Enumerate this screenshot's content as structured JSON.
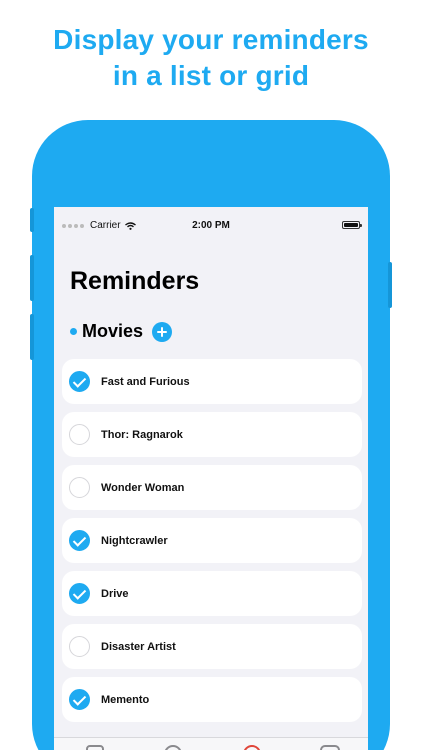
{
  "headline": {
    "line1": "Display your reminders",
    "line2": "in a list or grid"
  },
  "status_bar": {
    "carrier": "Carrier",
    "time": "2:00 PM"
  },
  "app": {
    "title": "Reminders",
    "section": {
      "label": "Movies",
      "add_icon": "plus-circle-icon"
    },
    "reminders": [
      {
        "label": "Fast and Furious",
        "done": true
      },
      {
        "label": "Thor: Ragnarok",
        "done": false
      },
      {
        "label": "Wonder Woman",
        "done": false
      },
      {
        "label": "Nightcrawler",
        "done": true
      },
      {
        "label": "Drive",
        "done": true
      },
      {
        "label": "Disaster Artist",
        "done": false
      },
      {
        "label": "Memento",
        "done": true
      }
    ],
    "tabs": [
      "list-tab-icon",
      "clock-tab-icon",
      "record-tab-icon",
      "settings-tab-icon"
    ]
  },
  "colors": {
    "accent": "#1eaaf1",
    "background": "#f2f2f7",
    "card": "#ffffff",
    "tab_active": "#e0463a"
  }
}
